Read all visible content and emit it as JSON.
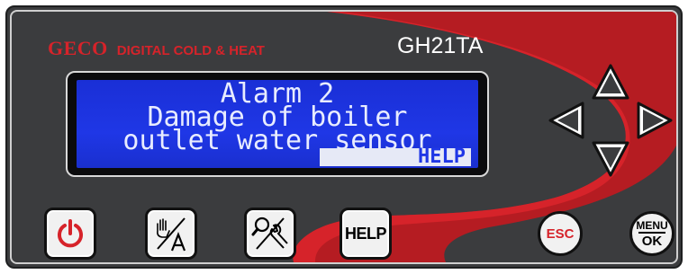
{
  "brand": {
    "logo": "GECO",
    "tagline": "DIGITAL COLD & HEAT",
    "model": "GH21TA"
  },
  "display": {
    "line1": "Alarm 2",
    "line2": "Damage of boiler",
    "line3": "outlet water sensor",
    "softkey": "HELP"
  },
  "buttons": {
    "help_label": "HELP",
    "esc_label": "ESC",
    "menu_label": "MENU",
    "ok_label": "OK"
  },
  "icons": {
    "power": "power-icon",
    "manual_auto": "hand-auto-icon",
    "service": "search-wrench-icon",
    "up": "arrow-up-icon",
    "down": "arrow-down-icon",
    "left": "arrow-left-icon",
    "right": "arrow-right-icon"
  },
  "colors": {
    "panel": "#3b3c3e",
    "accent_red": "#d6232a",
    "lcd_blue": "#1f37e6",
    "lcd_text": "#e8ecff"
  }
}
